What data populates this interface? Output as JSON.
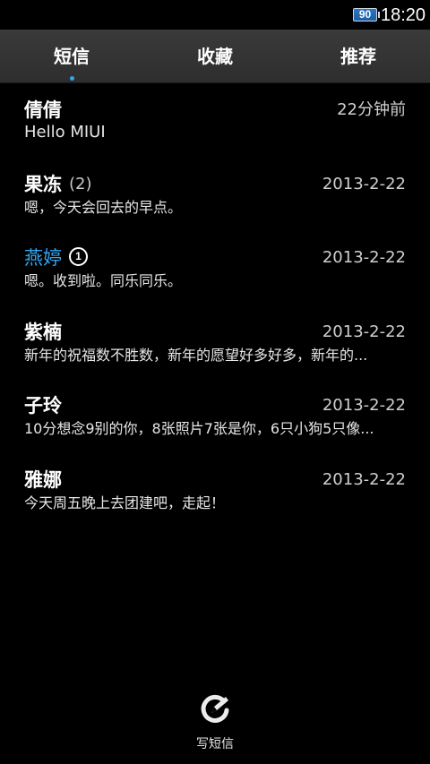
{
  "status_bar": {
    "battery": "90",
    "time": "18:20"
  },
  "tabs": [
    {
      "label": "短信",
      "active": true
    },
    {
      "label": "收藏",
      "active": false
    },
    {
      "label": "推荐",
      "active": false
    }
  ],
  "colors": {
    "accent": "#33a5ef",
    "background": "#000000",
    "tab_bar": "#333333"
  },
  "messages": [
    {
      "name": "倩倩",
      "count": "",
      "unread_badge": "",
      "time": "22分钟前",
      "preview": "Hello MIUI"
    },
    {
      "name": "果冻",
      "count": "(2)",
      "unread_badge": "",
      "time": "2013-2-22",
      "preview": "嗯，今天会回去的早点。"
    },
    {
      "name": "燕婷",
      "count": "",
      "unread_badge": "1",
      "time": "2013-2-22",
      "preview": "嗯。收到啦。同乐同乐。"
    },
    {
      "name": "紫楠",
      "count": "",
      "unread_badge": "",
      "time": "2013-2-22",
      "preview": "新年的祝福数不胜数，新年的愿望好多好多，新年的..."
    },
    {
      "name": "子玲",
      "count": "",
      "unread_badge": "",
      "time": "2013-2-22",
      "preview": "10分想念9别的你，8张照片7张是你，6只小狗5只像..."
    },
    {
      "name": "雅娜",
      "count": "",
      "unread_badge": "",
      "time": "2013-2-22",
      "preview": "今天周五晚上去团建吧，走起！"
    }
  ],
  "compose": {
    "label": "写短信",
    "icon": "compose-icon"
  }
}
